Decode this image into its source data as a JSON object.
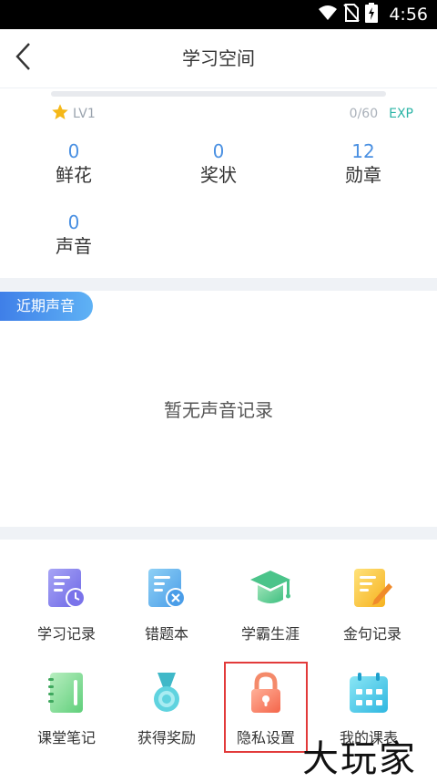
{
  "status_bar": {
    "time": "4:56"
  },
  "header": {
    "title": "学习空间"
  },
  "level": {
    "label": "LV1",
    "exp_count": "0/60",
    "exp_label": "EXP",
    "progress": 0
  },
  "stats": [
    {
      "value": "0",
      "label": "鲜花"
    },
    {
      "value": "0",
      "label": "奖状"
    },
    {
      "value": "12",
      "label": "勋章"
    },
    {
      "value": "0",
      "label": "声音"
    }
  ],
  "recent": {
    "tab_label": "近期声音",
    "empty_text": "暂无声音记录"
  },
  "grid": [
    {
      "label": "学习记录",
      "icon": "study-record-icon"
    },
    {
      "label": "错题本",
      "icon": "wrong-questions-icon"
    },
    {
      "label": "学霸生涯",
      "icon": "graduation-cap-icon"
    },
    {
      "label": "金句记录",
      "icon": "quotes-record-icon"
    },
    {
      "label": "课堂笔记",
      "icon": "notebook-icon"
    },
    {
      "label": "获得奖励",
      "icon": "medal-icon"
    },
    {
      "label": "隐私设置",
      "icon": "lock-icon"
    },
    {
      "label": "我的课表",
      "icon": "calendar-icon"
    }
  ],
  "watermark": "大玩家",
  "colors": {
    "accent": "#4a90e2",
    "exp": "#2bb4a6",
    "highlight": "#e23a3a"
  }
}
